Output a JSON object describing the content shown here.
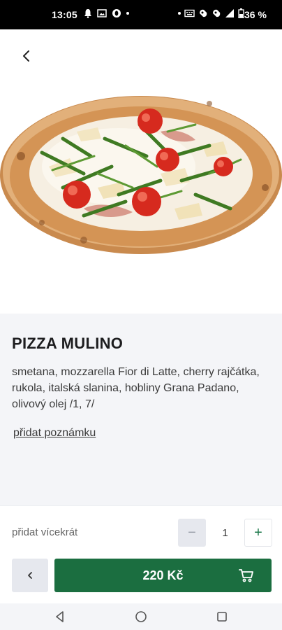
{
  "status_bar": {
    "time": "13:05",
    "battery": "36 %",
    "icons_left": [
      "notification-bell-icon",
      "image-icon",
      "circle-o-icon",
      "dot-icon"
    ],
    "icons_right": [
      "dot-icon",
      "keyboard-icon",
      "app-icon",
      "app-icon",
      "signal-icon",
      "battery-icon"
    ]
  },
  "header": {
    "back_icon": "chevron-left-icon"
  },
  "product": {
    "image": "pizza-photo",
    "name": "PIZZA MULINO",
    "description": "smetana, mozzarella Fior di Latte, cherry rajčátka, rukola, italská slanina, hobliny Grana Padano, olivový olej /1, 7/",
    "note_link": "přidat poznámku"
  },
  "quantity": {
    "label": "přidat vícekrát",
    "minus": "−",
    "value": "1",
    "plus": "+"
  },
  "actions": {
    "back_icon": "chevron-left-icon",
    "add_to_cart_label": "220 Kč",
    "cart_icon": "cart-icon"
  },
  "colors": {
    "accent": "#1b6e40",
    "plus_color": "#1f7a4d",
    "background": "#f4f5f8"
  },
  "system_nav": [
    "back-triangle-icon",
    "home-circle-icon",
    "recents-square-icon"
  ]
}
